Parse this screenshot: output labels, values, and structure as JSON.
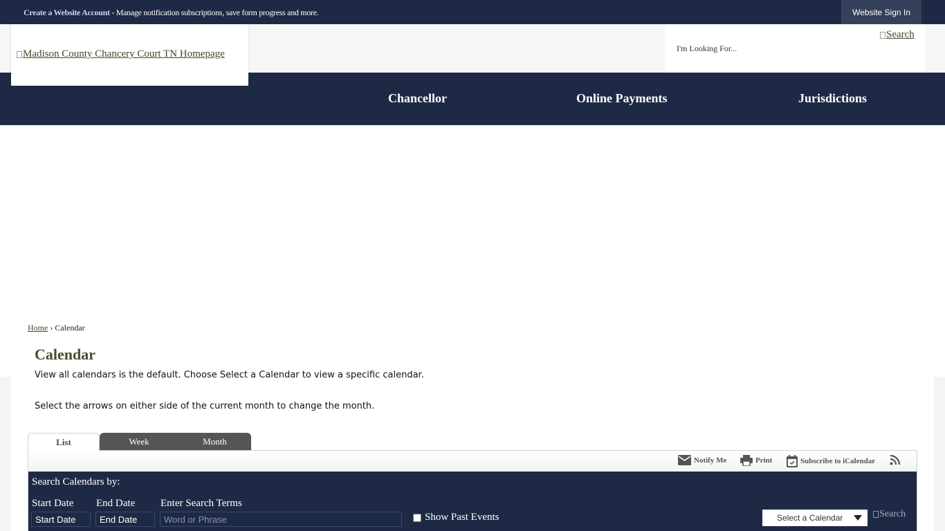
{
  "topbar": {
    "create_account_link": "Create a Website Account",
    "message": " - Manage notification subscriptions, save form progress and more.",
    "signin_label": "Website Sign In"
  },
  "header": {
    "logo_alt": "Madison County Chancery Court TN Homepage",
    "search_placeholder": "I'm Looking For...",
    "search_alt": "Search"
  },
  "nav": {
    "items": [
      {
        "label": "Chancellor"
      },
      {
        "label": "Online Payments"
      },
      {
        "label": "Jurisdictions"
      }
    ]
  },
  "breadcrumb": {
    "home": "Home",
    "separator": " › ",
    "current": "Calendar"
  },
  "page": {
    "title": "Calendar",
    "intro_1": "View all calendars is the default. Choose Select a Calendar to view a specific calendar.",
    "intro_2": "Select the arrows on either side of the current month to change the month."
  },
  "tabs": [
    {
      "label": "List",
      "active": true
    },
    {
      "label": "Week",
      "active": false
    },
    {
      "label": "Month",
      "active": false
    }
  ],
  "toolbar": {
    "notify_label": "Notify Me",
    "print_label": "Print",
    "subscribe_label": "Subscribe to iCalendar",
    "icons": [
      "mail-icon",
      "printer-icon",
      "calendar-icon",
      "rss-icon"
    ]
  },
  "search_panel": {
    "heading": "Search Calendars by:",
    "start_date_label": "Start Date",
    "start_date_value": "Start Date",
    "end_date_label": "End Date",
    "end_date_value": "End Date",
    "terms_label": "Enter Search Terms",
    "terms_placeholder": "Word or Phrase",
    "past_events_label": "Show Past Events",
    "select_calendar_label": "Select a Calendar",
    "search_alt": "Search"
  },
  "colors": {
    "navy": "#1e2a45",
    "olive": "#44502a",
    "tab_dark": "#555555"
  }
}
